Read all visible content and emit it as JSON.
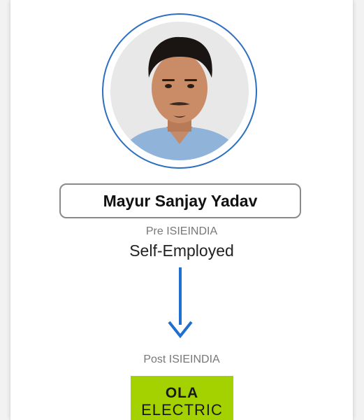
{
  "profile": {
    "name": "Mayur Sanjay Yadav",
    "photo_icon": "profile-photo"
  },
  "before": {
    "label": "Pre ISIEINDIA",
    "value": "Self-Employed"
  },
  "after": {
    "label": "Post ISIEINDIA",
    "logo_line1": "OLA",
    "logo_line2": "ELECTRIC"
  },
  "colors": {
    "accent_blue": "#2c6fc2",
    "arrow_blue": "#1f6fd1",
    "logo_green": "#a4d100"
  }
}
